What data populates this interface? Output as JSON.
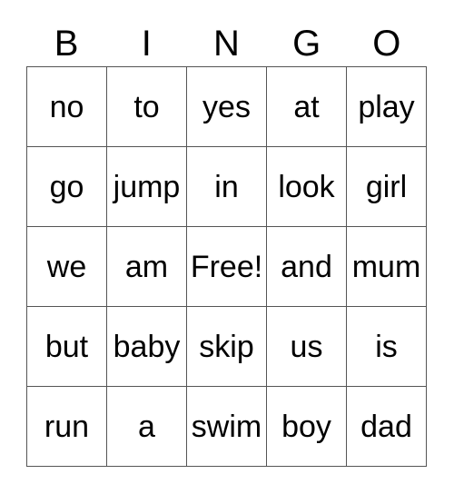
{
  "card": {
    "title_letters": [
      "B",
      "I",
      "N",
      "G",
      "O"
    ],
    "rows": [
      {
        "cells": [
          "no",
          "to",
          "yes",
          "at",
          "play"
        ]
      },
      {
        "cells": [
          "go",
          "jump",
          "in",
          "look",
          "girl"
        ]
      },
      {
        "cells": [
          "we",
          "am",
          "Free!",
          "and",
          "mum"
        ]
      },
      {
        "cells": [
          "but",
          "baby",
          "skip",
          "us",
          "is"
        ]
      },
      {
        "cells": [
          "run",
          "a",
          "swim",
          "boy",
          "dad"
        ]
      }
    ],
    "free_space": "Free!",
    "colors": {
      "background": "#ffffff",
      "text": "#000000",
      "grid_line": "#555555"
    }
  }
}
